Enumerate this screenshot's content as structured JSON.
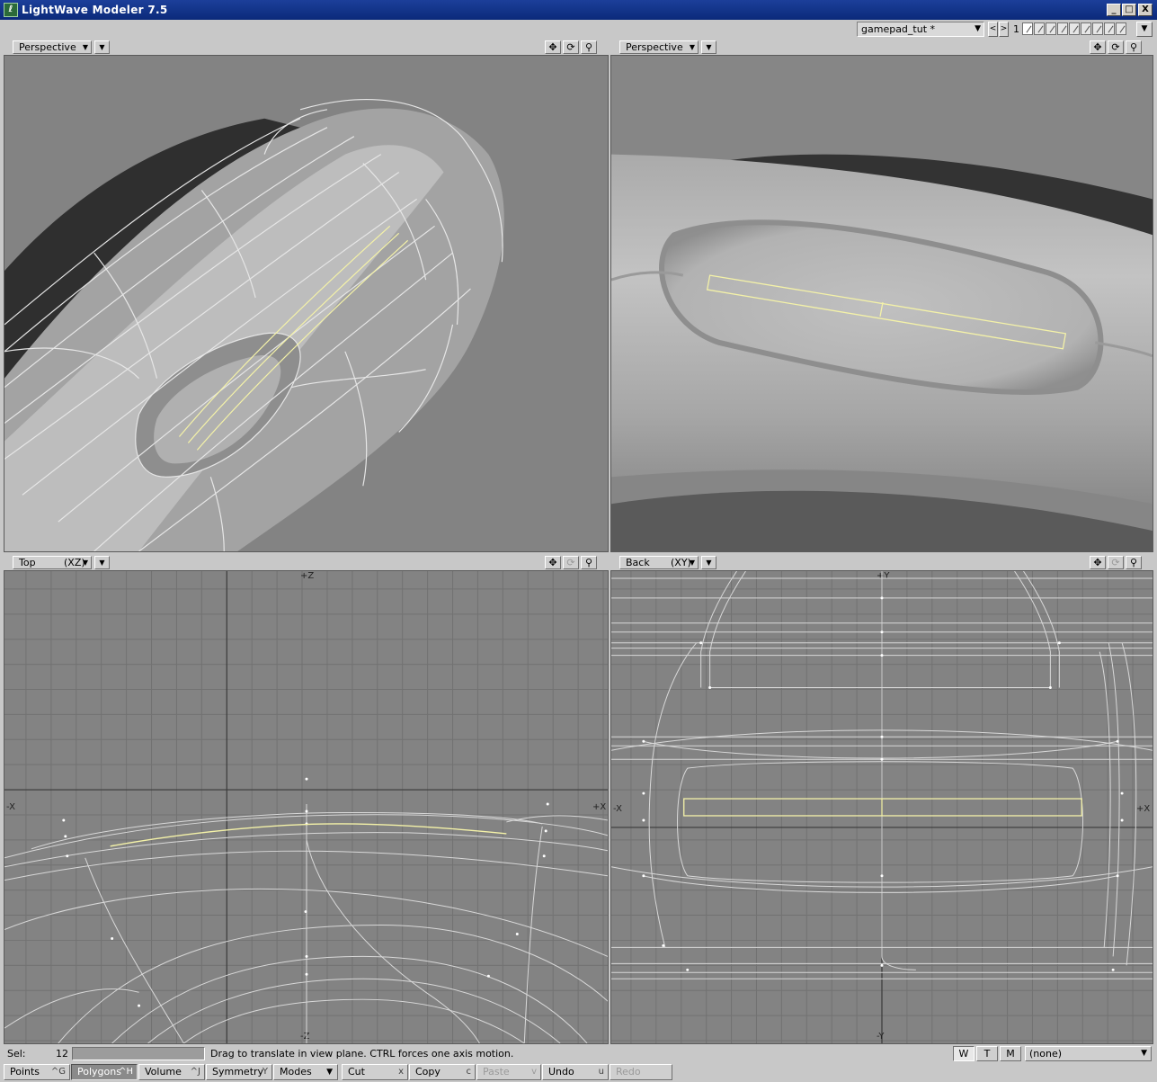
{
  "window": {
    "title": "LightWave Modeler 7.5",
    "app_icon": "lightwave-icon",
    "minimize": "_",
    "maximize": "□",
    "close": "X"
  },
  "scene": {
    "object_name": "gamepad_tut *",
    "prev": "<",
    "next": ">",
    "layer_number": "1",
    "layer_menu": "▼"
  },
  "viewports": {
    "tl": {
      "view": "Perspective",
      "axis": ""
    },
    "tr": {
      "view": "Perspective",
      "axis": ""
    },
    "bl": {
      "view": "Top",
      "axis": "(XZ)",
      "label_top": "+Z",
      "label_bottom": "-Z",
      "label_left": "-X",
      "label_right": "+X"
    },
    "br": {
      "view": "Back",
      "axis": "(XY)",
      "label_top": "+Y",
      "label_bottom": "-Y",
      "label_left": "-X",
      "label_right": "+X"
    }
  },
  "icons": {
    "move": "✥",
    "rotate": "⟳",
    "zoom": "⚲",
    "dropdown": "▼"
  },
  "status": {
    "sel_label": "Sel:",
    "sel_count": "12",
    "help": "Drag to translate in view plane. CTRL forces one axis motion.",
    "w": "W",
    "t": "T",
    "m": "M",
    "surface": "(none)"
  },
  "toolbar": {
    "points": {
      "label": "Points",
      "key": "^G"
    },
    "polygons": {
      "label": "Polygons",
      "key": "^H"
    },
    "volume": {
      "label": "Volume",
      "key": "^J"
    },
    "symmetry": {
      "label": "Symmetry",
      "key": "Y"
    },
    "modes": {
      "label": "Modes"
    },
    "cut": {
      "label": "Cut",
      "key": "x"
    },
    "copy": {
      "label": "Copy",
      "key": "c"
    },
    "paste": {
      "label": "Paste",
      "key": "v"
    },
    "undo": {
      "label": "Undo",
      "key": "u"
    },
    "redo": {
      "label": "Redo",
      "key": ""
    }
  },
  "colors": {
    "title_bar": "#0b2a7a",
    "viewport_bg": "#838383",
    "grid_line": "#6e6e6e",
    "wireframe": "#e6e6e6",
    "selection": "#f4f2a8"
  }
}
